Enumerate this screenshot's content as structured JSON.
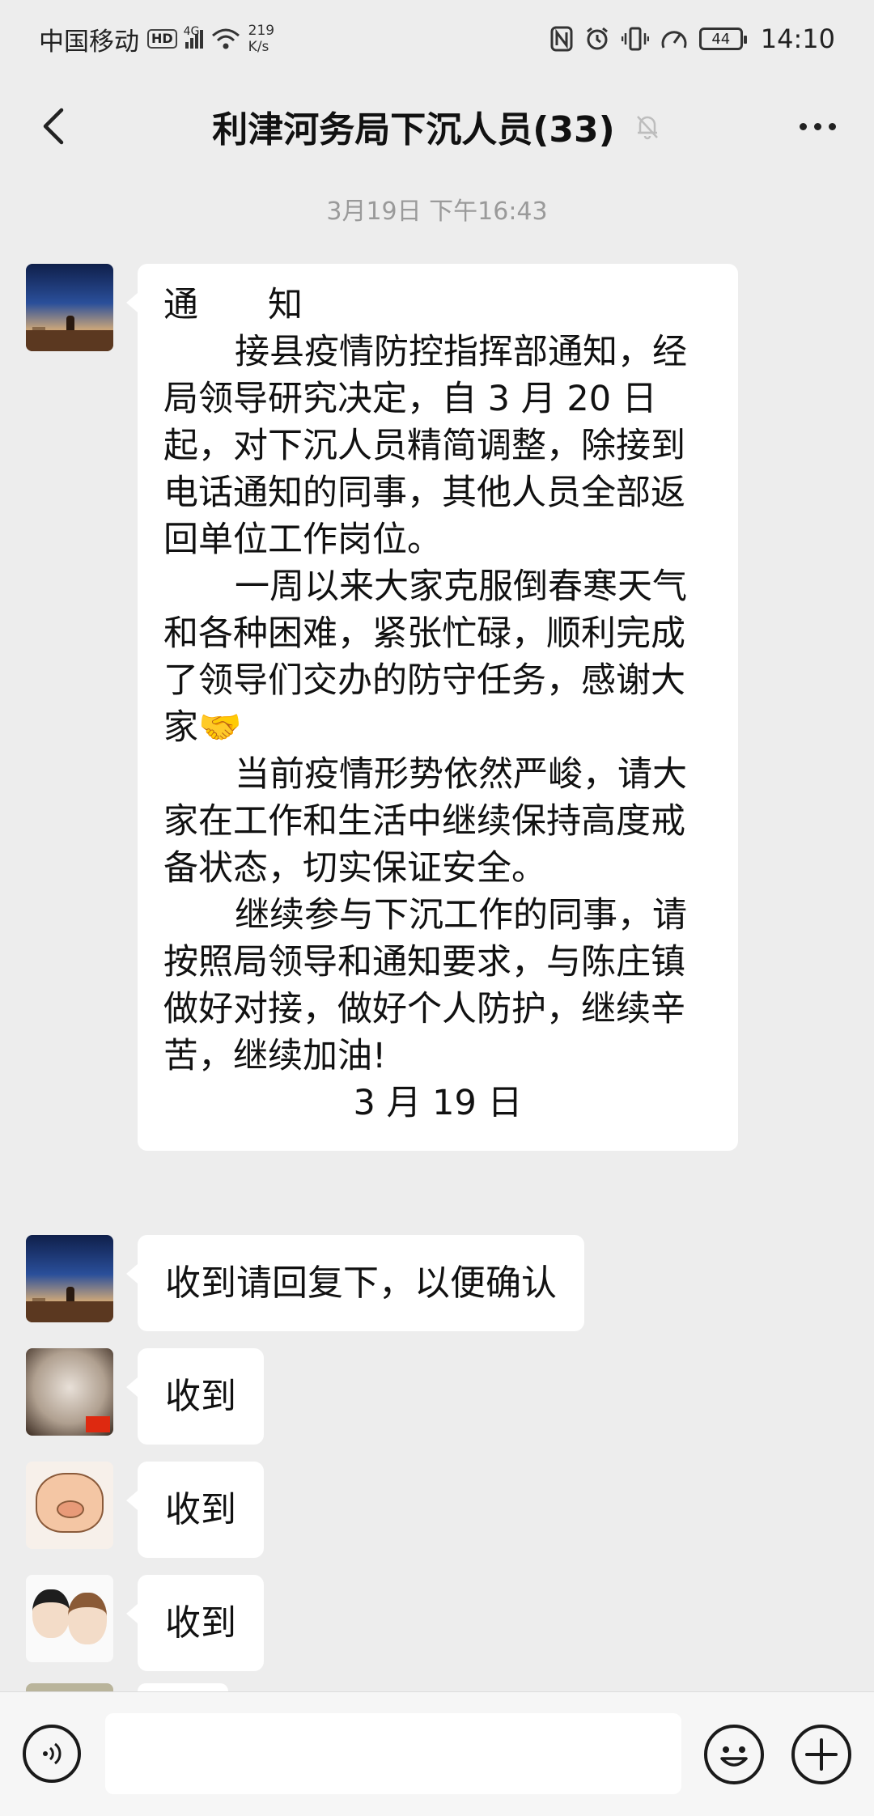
{
  "status_bar": {
    "carrier": "中国移动",
    "hd": "HD",
    "network": "4G",
    "speed_value": "219",
    "speed_unit": "K/s",
    "battery": "44",
    "time": "14:10"
  },
  "chat": {
    "title": "利津河务局下沉人员(33)",
    "timestamp": "3月19日 下午16:43"
  },
  "messages": [
    {
      "avatar": "sunset-field-avatar",
      "notice": {
        "heading": "通　　知",
        "paragraphs": [
          "接县疫情防控指挥部通知，经局领导研究决定，自 3 月 20 日起，对下沉人员精简调整，除接到电话通知的同事，其他人员全部返回单位工作岗位。",
          "一周以来大家克服倒春寒天气和各种困难，紧张忙碌，顺利完成了领导们交办的防守任务，感谢大家🤝",
          "当前疫情形势依然严峻，请大家在工作和生活中继续保持高度戒备状态，切实保证安全。",
          "继续参与下沉工作的同事，请按照局领导和通知要求，与陈庄镇做好对接，做好个人防护，继续辛苦，继续加油!"
        ],
        "date": "3 月 19 日"
      }
    },
    {
      "avatar": "sunset-field-avatar",
      "text": "收到请回复下，以便确认"
    },
    {
      "avatar": "mask-flag-avatar",
      "text": "收到"
    },
    {
      "avatar": "pig-avatar",
      "text": "收到"
    },
    {
      "avatar": "cartoon-couple-avatar",
      "text": "收到"
    }
  ],
  "input": {
    "placeholder": ""
  },
  "icons": {
    "back": "chevron-left-icon",
    "mute": "bell-off-icon",
    "more": "more-dots-icon",
    "voice": "voice-icon",
    "emoji": "emoji-icon",
    "plus": "plus-icon"
  }
}
